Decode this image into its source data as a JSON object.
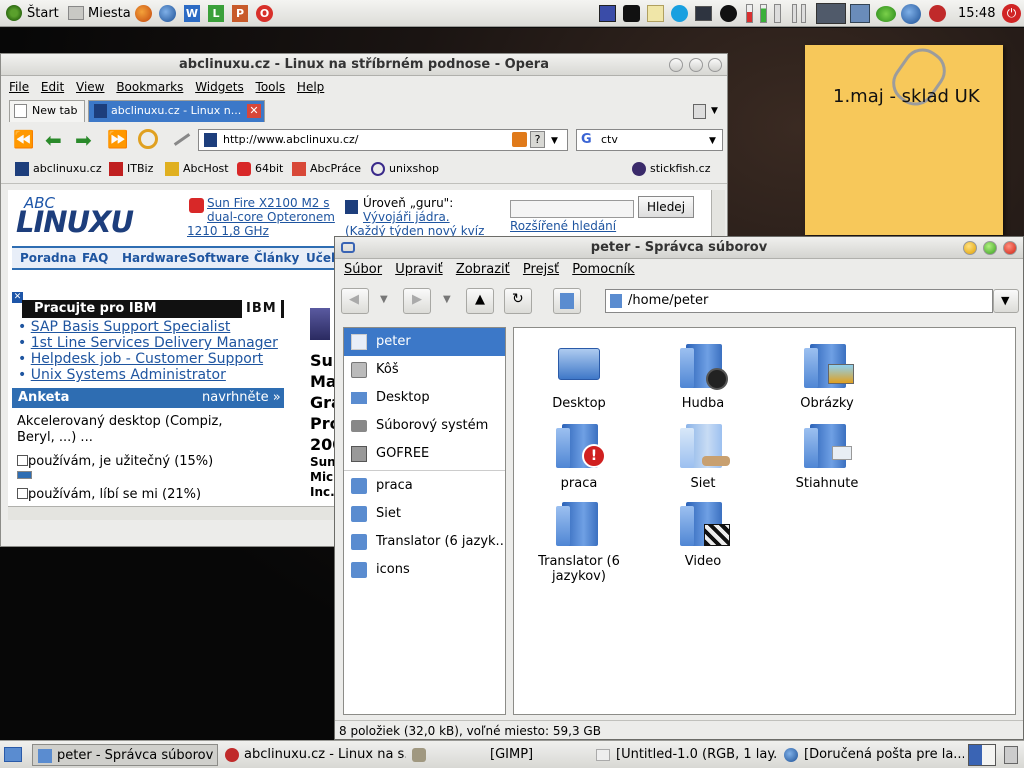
{
  "top_panel": {
    "start_label": "Štart",
    "places_label": "Miesta",
    "clock": "15:48"
  },
  "sticky_note": {
    "text": "1.maj - sklad UK"
  },
  "opera": {
    "title": "abclinuxu.cz - Linux na stříbrném podnose - Opera",
    "menu": [
      "File",
      "Edit",
      "View",
      "Bookmarks",
      "Widgets",
      "Tools",
      "Help"
    ],
    "tabs": {
      "new_tab": "New tab",
      "active_tab": "abclinuxu.cz - Linux n..."
    },
    "address": "http://www.abclinuxu.cz/",
    "search_value": "ctv",
    "bookmarks": [
      "abclinuxu.cz",
      "ITBiz",
      "AbcHost",
      "64bit",
      "AbcPráce",
      "unixshop",
      "stickfish.cz"
    ],
    "page": {
      "logo_top": "ABC",
      "logo_bottom": "LINUXU",
      "news_link": "Sun Fire X2100 M2 s dual-core Opteronem",
      "news_sub": "1210 1,8 GHz",
      "level_label": "Úroveň „guru\":",
      "level_link": "Vývojáři jádra.",
      "level_weekly": "(Každý týden nový kvíz",
      "search_button": "Hledej",
      "advanced_search": "Rozšířené hledání",
      "nav": [
        "Poradna",
        "FAQ",
        "Hardware",
        "Software",
        "Články",
        "Učebn"
      ],
      "ibm_box_title": "Pracujte pro IBM",
      "ibm_logo": "IBM",
      "jobs": [
        "SAP Basis Support Specialist",
        "1st Line Services Delivery Manager",
        "Helpdesk job - Customer Support",
        "Unix Systems Administrator"
      ],
      "poll_title": "Anketa",
      "poll_suggest": "navrhněte »",
      "poll_question": "Akcelerovaný desktop (Compiz, Beryl, ...) ...",
      "poll_options": [
        "používám, je užitečný (15%)",
        "používám, líbí se mi (21%)"
      ],
      "poll_fractions": [
        0.15,
        0.21
      ],
      "side_text": [
        "Sun",
        "Ma",
        "Gra",
        "Pro",
        "200",
        "Sun",
        "Micr",
        "Inc."
      ]
    }
  },
  "file_manager": {
    "title": "peter - Správca súborov",
    "menu": [
      "Súbor",
      "Upraviť",
      "Zobraziť",
      "Prejsť",
      "Pomocník"
    ],
    "location": "/home/peter",
    "sidebar": [
      "peter",
      "Kôš",
      "Desktop",
      "Súborový systém",
      "GOFREE",
      "praca",
      "Siet",
      "Translator (6 jazyk...",
      "icons"
    ],
    "items": [
      "Desktop",
      "Hudba",
      "Obrázky",
      "praca",
      "Siet",
      "Stiahnute",
      "Translator (6 jazykov)",
      "Video"
    ],
    "status": "8 položiek (32,0 kB), voľné miesto: 59,3 GB"
  },
  "taskbar": {
    "tasks": [
      "peter - Správca súborov",
      "abclinuxu.cz - Linux na s...",
      "[GIMP]",
      "[Untitled-1.0 (RGB, 1 lay...",
      "[Doručená pošta pre la..."
    ]
  },
  "colors": {
    "accent_blue": "#3c78c8",
    "opera_close": "#d8473a",
    "note_yellow": "#f7c85a",
    "page_nav_blue": "#2e6db2"
  }
}
